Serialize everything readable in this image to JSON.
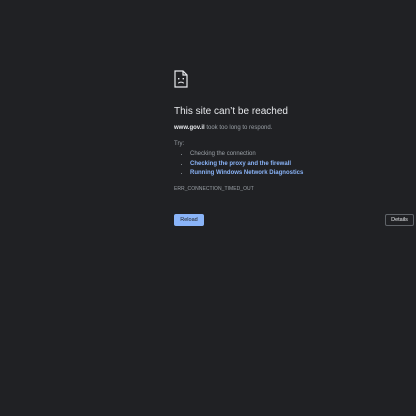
{
  "error_page": {
    "icon": "sad-page-icon",
    "title": "This site can’t be reached",
    "domain": "www.gov.il",
    "description_suffix": " took too long to respond.",
    "try_label": "Try:",
    "suggestions": [
      "Checking the connection",
      "Checking the proxy and the firewall",
      "Running Windows Network Diagnostics"
    ],
    "error_code": "ERR_CONNECTION_TIMED_OUT",
    "reload_label": "Reload",
    "details_label": "Details"
  },
  "colors": {
    "background": "#202124",
    "title": "#e8eaed",
    "body_text": "#9aa0a6",
    "link": "#8ab4f8",
    "button_primary": "#8ab4f8",
    "button_border": "#5f6368"
  }
}
